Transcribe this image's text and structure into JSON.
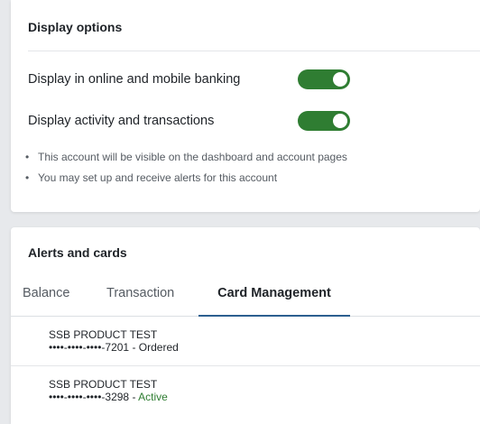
{
  "display_options": {
    "title": "Display options",
    "toggles": [
      {
        "label": "Display in online and mobile banking",
        "state": "on"
      },
      {
        "label": "Display activity and transactions",
        "state": "on"
      }
    ],
    "notes": [
      "This account will be visible on the dashboard and account pages",
      "You may set up and receive alerts for this account"
    ]
  },
  "alerts_and_cards": {
    "title": "Alerts and cards",
    "tabs": [
      {
        "label": "Balance",
        "selected": false
      },
      {
        "label": "Transaction",
        "selected": false
      },
      {
        "label": "Card Management",
        "selected": true
      }
    ],
    "cards": [
      {
        "name": "SSB PRODUCT TEST",
        "masked_number": "••••-••••-••••-7201",
        "separator": " - ",
        "status": "Ordered"
      },
      {
        "name": "SSB PRODUCT TEST",
        "masked_number": "••••-••••-••••-3298",
        "separator": " - ",
        "status": "Active"
      }
    ]
  },
  "colors": {
    "toggle_on": "#2f7d32",
    "active_status": "#2f7d32",
    "tab_underline": "#2c5f8f"
  }
}
